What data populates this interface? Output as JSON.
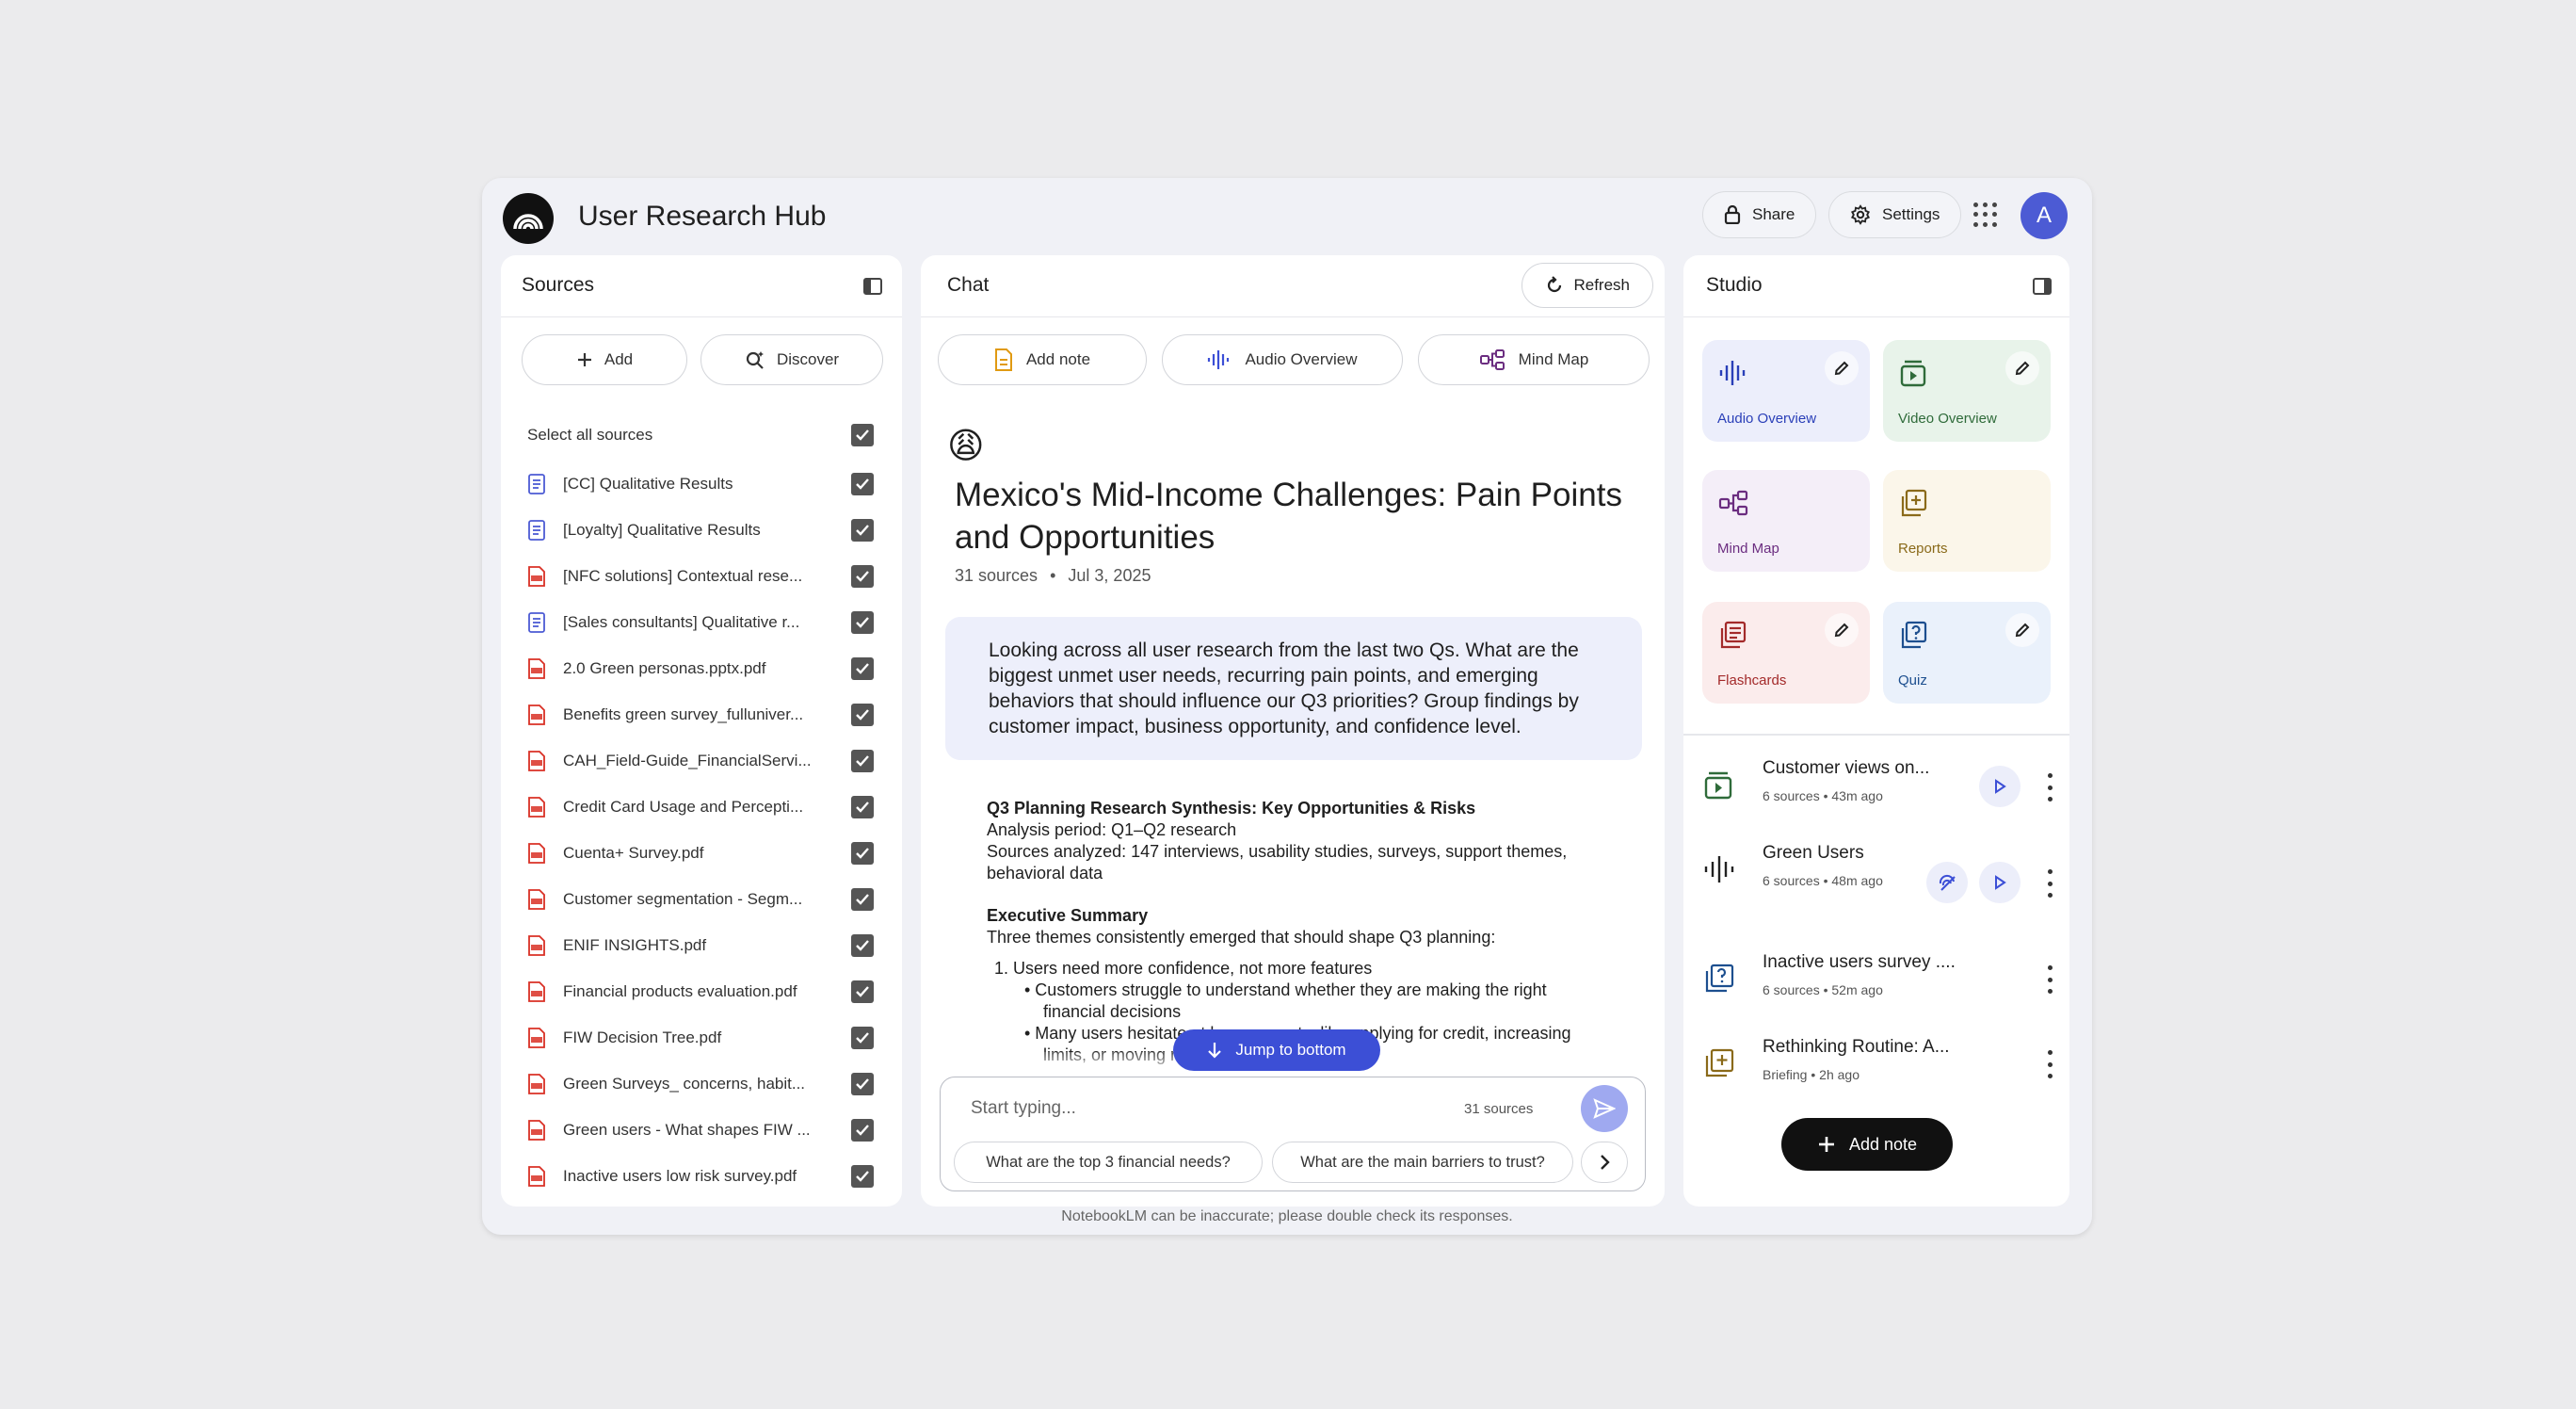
{
  "app": {
    "title": "User Research Hub"
  },
  "topbar": {
    "share_label": "Share",
    "settings_label": "Settings",
    "avatar_initial": "A"
  },
  "sources": {
    "title": "Sources",
    "add_label": "Add",
    "discover_label": "Discover",
    "select_all_label": "Select all sources",
    "items": [
      {
        "name": "[CC] Qualitative Results",
        "type": "doc"
      },
      {
        "name": "[Loyalty] Qualitative Results",
        "type": "doc"
      },
      {
        "name": "[NFC solutions] Contextual rese...",
        "type": "pdf"
      },
      {
        "name": "[Sales consultants] Qualitative r...",
        "type": "doc"
      },
      {
        "name": "2.0 Green personas.pptx.pdf",
        "type": "pdf"
      },
      {
        "name": "Benefits green survey_fulluniver...",
        "type": "pdf"
      },
      {
        "name": "CAH_Field-Guide_FinancialServi...",
        "type": "pdf"
      },
      {
        "name": "Credit Card Usage and Percepti...",
        "type": "pdf"
      },
      {
        "name": "Cuenta+ Survey.pdf",
        "type": "pdf"
      },
      {
        "name": "Customer segmentation - Segm...",
        "type": "pdf"
      },
      {
        "name": "ENIF INSIGHTS.pdf",
        "type": "pdf"
      },
      {
        "name": "Financial products evaluation.pdf",
        "type": "pdf"
      },
      {
        "name": "FIW Decision Tree.pdf",
        "type": "pdf"
      },
      {
        "name": "Green Surveys_ concerns, habit...",
        "type": "pdf"
      },
      {
        "name": "Green users - What shapes FIW ...",
        "type": "pdf"
      },
      {
        "name": "Inactive users low risk survey.pdf",
        "type": "pdf"
      }
    ]
  },
  "chat": {
    "title": "Chat",
    "refresh_label": "Refresh",
    "actions": {
      "add_note": "Add note",
      "audio_overview": "Audio Overview",
      "mind_map": "Mind Map"
    },
    "emoji": "😩",
    "heading": "Mexico's Mid-Income Challenges: Pain Points and Opportunities",
    "source_count": "31 sources",
    "date": "Jul 3, 2025",
    "prompt": "Looking across all user research from the last two Qs. What are the biggest unmet user needs, recurring pain points, and emerging behaviors that should influence our Q3 priorities? Group findings by customer impact, business opportunity, and confidence level.",
    "response": {
      "title": "Q3 Planning Research Synthesis: Key Opportunities & Risks",
      "period": "Analysis period: Q1–Q2 research",
      "analyzed": "Sources analyzed: 147 interviews, usability studies, surveys, support themes, behavioral data",
      "exec_title": "Executive Summary",
      "exec_text": "Three themes consistently emerged that should shape Q3 planning:",
      "item1": "1.  Users need more confidence, not more features",
      "sub1": "•  Customers struggle to understand whether they are making the right financial decisions",
      "sub2": "•  Many users hesitate at key moments, like applying for credit, increasing limits, or moving money"
    },
    "jump_label": "Jump to bottom",
    "composer": {
      "placeholder": "Start typing...",
      "source_count": "31 sources",
      "suggestions": [
        "What are the top 3 financial needs?",
        "What are the main barriers to trust?"
      ]
    },
    "disclaimer": "NotebookLM can be inaccurate; please double check its responses."
  },
  "studio": {
    "title": "Studio",
    "tiles": [
      {
        "label": "Audio Overview",
        "bg": "#eceefb",
        "color": "#2a3fb8"
      },
      {
        "label": "Video Overview",
        "bg": "#e8f3ea",
        "color": "#2f6b3a"
      },
      {
        "label": "Mind Map",
        "bg": "#f4eef8",
        "color": "#6b2d80"
      },
      {
        "label": "Reports",
        "bg": "#fbf6ea",
        "color": "#8a6a1a"
      },
      {
        "label": "Flashcards",
        "bg": "#fbecec",
        "color": "#a32a2a"
      },
      {
        "label": "Quiz",
        "bg": "#eaf1fb",
        "color": "#1d4f8f"
      }
    ],
    "outputs": [
      {
        "title": "Customer views on...",
        "sources": "6 sources",
        "time": "43m ago"
      },
      {
        "title": "Green Users",
        "sources": "6 sources",
        "time": "48m ago"
      },
      {
        "title": "Inactive users survey ....",
        "sources": "6 sources",
        "time": "52m ago"
      },
      {
        "title": "Rethinking Routine: A...",
        "sources": "Briefing",
        "time": "2h ago"
      }
    ],
    "add_note_label": "Add note"
  },
  "colors": {
    "accent": "#3c4fd6",
    "pdf_red": "#d93025",
    "doc_blue": "#4c5bd4"
  }
}
